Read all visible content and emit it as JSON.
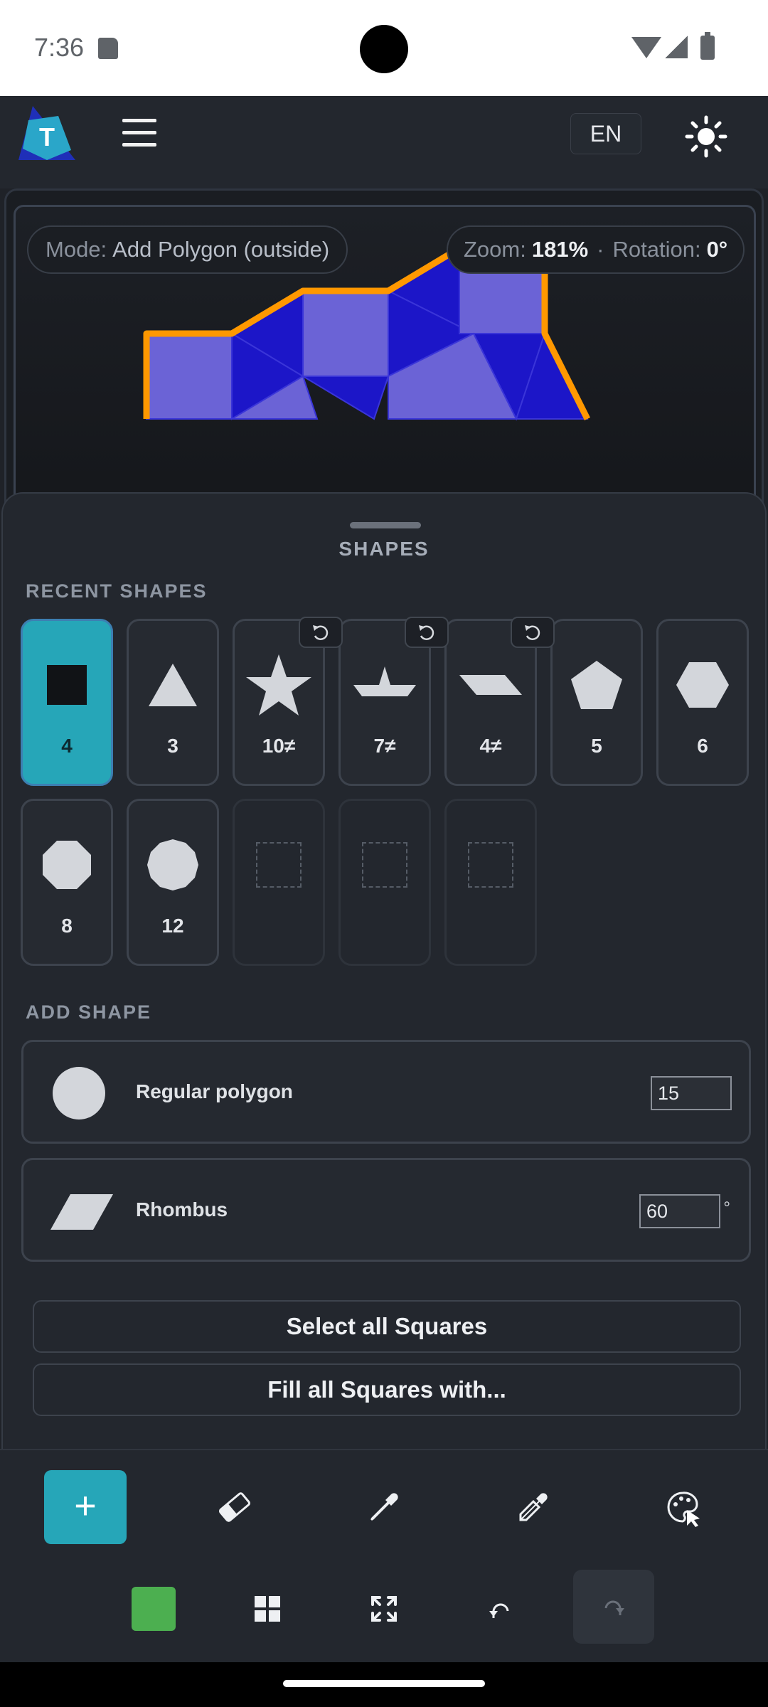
{
  "status": {
    "time": "7:36"
  },
  "header": {
    "logo_letter": "T",
    "lang": "EN"
  },
  "canvas": {
    "mode_label": "Mode:",
    "mode_value": "Add Polygon (outside)",
    "zoom_label": "Zoom:",
    "zoom_value": "181%",
    "separator": "·",
    "rotation_label": "Rotation:",
    "rotation_value": "0°"
  },
  "sheet": {
    "title": "SHAPES",
    "recent_label": "RECENT SHAPES",
    "recent_shapes": [
      {
        "count": "4",
        "shape": "square-icon",
        "selected": true
      },
      {
        "count": "3",
        "shape": "triangle-icon"
      },
      {
        "count": "10≠",
        "shape": "star-icon",
        "reset": true
      },
      {
        "count": "7≠",
        "shape": "irregular-heptagon-icon",
        "reset": true
      },
      {
        "count": "4≠",
        "shape": "parallelogram-icon",
        "reset": true
      },
      {
        "count": "5",
        "shape": "pentagon-icon"
      },
      {
        "count": "6",
        "shape": "hexagon-icon"
      },
      {
        "count": "8",
        "shape": "octagon-icon"
      },
      {
        "count": "12",
        "shape": "dodecagon-icon"
      }
    ],
    "add_label": "ADD SHAPE",
    "regular_polygon": {
      "label": "Regular polygon",
      "value": "15"
    },
    "rhombus": {
      "label": "Rhombus",
      "value": "60",
      "unit": "°"
    },
    "select_all": "Select all Squares",
    "fill_all": "Fill all Squares with..."
  },
  "toolbar": {
    "add_label": "+",
    "fill_color": "#4caf50",
    "tools": [
      "eraser-icon",
      "eyedropper-icon",
      "edit-fill-icon",
      "palette-icon",
      "grid-icon",
      "fit-screen-icon",
      "undo-icon",
      "redo-icon"
    ]
  },
  "colors": {
    "accent": "#26a6b8",
    "tile_blue": "#1c16c8",
    "tile_light": "#6b63d6",
    "outline": "#ff9800"
  }
}
